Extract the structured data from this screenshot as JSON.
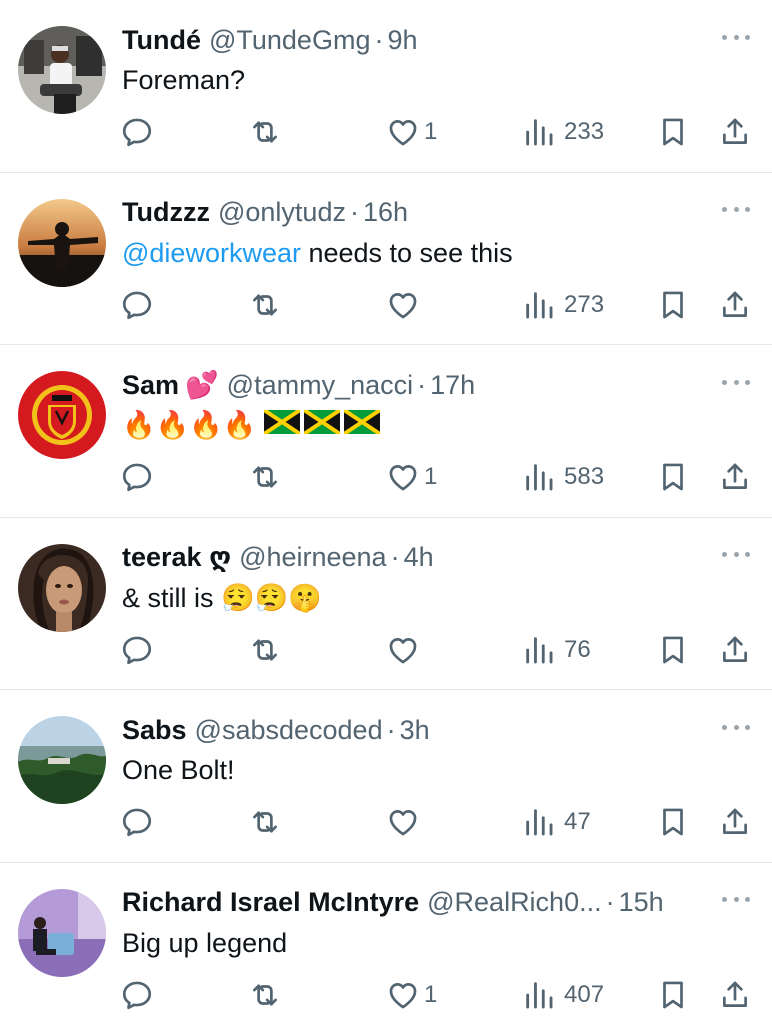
{
  "colors": {
    "text": "#0f1419",
    "secondary": "#536471",
    "mention": "#1d9bf0",
    "divider": "#e6e9ec"
  },
  "icons": {
    "reply": "reply-icon",
    "retweet": "retweet-icon",
    "like": "heart-icon",
    "views": "views-icon",
    "bookmark": "bookmark-icon",
    "share": "share-icon",
    "more": "more-icon"
  },
  "tweets": [
    {
      "name": "Tundé",
      "handle": "@TundeGmg",
      "sep": "·",
      "time": "9h",
      "text": "Foreman?",
      "likes": "1",
      "views": "233"
    },
    {
      "name": "Tudzzz",
      "handle": "@onlytudz",
      "sep": "·",
      "time": "16h",
      "mention": "@dieworkwear",
      "text": " needs to see this",
      "likes": "",
      "views": "273"
    },
    {
      "name": "Sam",
      "name_emoji": "💕",
      "handle": "@tammy_nacci",
      "sep": "·",
      "time": "17h",
      "text": "🔥🔥🔥🔥",
      "likes": "1",
      "views": "583"
    },
    {
      "name": "teerak ღ",
      "handle": "@heirneena",
      "sep": "·",
      "time": "4h",
      "text": "& still is 😮‍💨😮‍💨🤫",
      "likes": "",
      "views": "76"
    },
    {
      "name": "Sabs",
      "handle": "@sabsdecoded",
      "sep": "·",
      "time": "3h",
      "text": "One Bolt!",
      "likes": "",
      "views": "47"
    },
    {
      "name": "Richard Israel McIntyre",
      "handle": "@RealRich0...",
      "sep": "·",
      "time": "15h",
      "text": "Big up legend",
      "likes": "1",
      "views": "407"
    }
  ]
}
